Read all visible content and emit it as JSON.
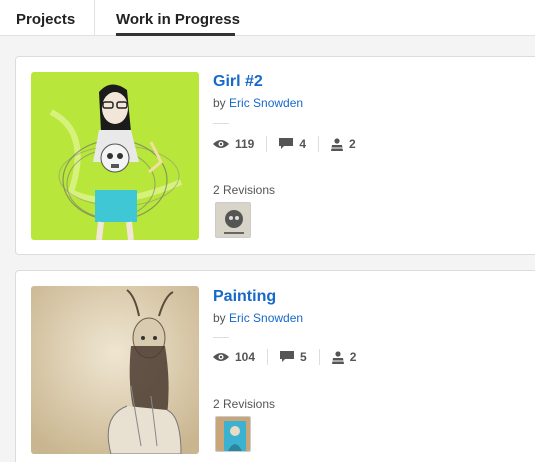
{
  "tabs": {
    "projects": "Projects",
    "work_in_progress": "Work in Progress",
    "active": "Work in Progress"
  },
  "items": [
    {
      "title": "Girl #2",
      "by": "by",
      "author": "Eric Snowden",
      "views": "119",
      "comments": "4",
      "collaborators": "2",
      "revisions": "2 Revisions",
      "thumb_bg": "#b8e63a"
    },
    {
      "title": "Painting",
      "by": "by",
      "author": "Eric Snowden",
      "views": "104",
      "comments": "5",
      "collaborators": "2",
      "revisions": "2 Revisions",
      "thumb_bg": "#e3d5b8"
    }
  ],
  "icons": {
    "views": "eye-icon",
    "comments": "comment-icon",
    "collaborators": "user-icon"
  },
  "colors": {
    "link": "#1769c9",
    "text": "#555555"
  }
}
